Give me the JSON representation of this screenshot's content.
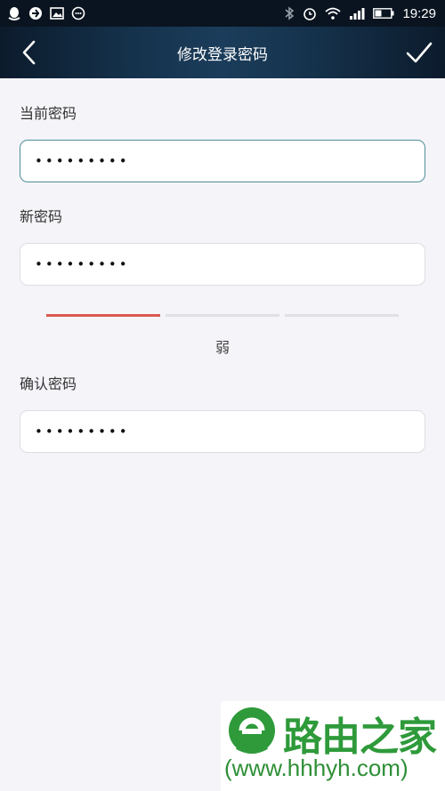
{
  "status_bar": {
    "time": "19:29",
    "left_icons": [
      "qq-icon",
      "browser-icon",
      "image-icon",
      "chat-icon"
    ],
    "right_icons": [
      "bluetooth-icon",
      "alarm-icon",
      "wifi-icon",
      "signal-icon",
      "battery-icon"
    ]
  },
  "header": {
    "title": "修改登录密码"
  },
  "form": {
    "current_password_label": "当前密码",
    "current_password_value": "•••••••••",
    "new_password_label": "新密码",
    "new_password_value": "•••••••••",
    "strength_level": 1,
    "strength_segments": 3,
    "strength_text": "弱",
    "strength_color": "#d9584f",
    "confirm_password_label": "确认密码",
    "confirm_password_value": "•••••••••"
  },
  "watermark": {
    "title": "路由之家",
    "url": "(www.hhhyh.com)"
  },
  "colors": {
    "nav_background": "#15324c",
    "focus_border": "#4e8f95",
    "page_background": "#f5f4f9",
    "brand_green": "#2e9a3a"
  }
}
